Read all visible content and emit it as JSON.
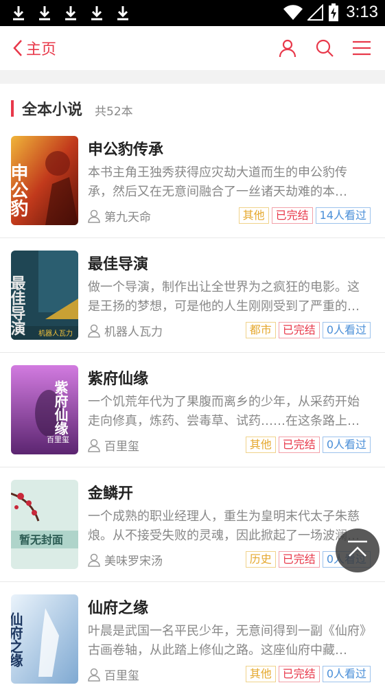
{
  "status_bar": {
    "time": "3:13",
    "download_icons": [
      "download-icon",
      "download-icon",
      "download-icon",
      "download-icon",
      "download-icon"
    ],
    "icons": [
      "wifi-icon",
      "signal-icon",
      "battery-charging-icon"
    ]
  },
  "nav": {
    "back_label": "主页",
    "icons": [
      "user-icon",
      "search-icon",
      "menu-icon"
    ],
    "accent": "#e8384a"
  },
  "section": {
    "title": "全本小说",
    "count": "共52本"
  },
  "books": [
    {
      "title": "申公豹传承",
      "description": "本书主角王独秀获得应灾劫大道而生的申公豹传承，然后又在无意间融合了一丝诸天劫难的本源……",
      "author": "第九天命",
      "category": "其他",
      "status": "已完结",
      "views": "14人看过"
    },
    {
      "title": "最佳导演",
      "description": "做一个导演，制作出让全世界为之疯狂的电影。这是王扬的梦想，可是他的人生刚刚受到了严重的打击……",
      "author": "机器人瓦力",
      "category": "都市",
      "status": "已完结",
      "views": "0人看过"
    },
    {
      "title": "紫府仙缘",
      "description": "一个饥荒年代为了果腹而离乡的少年，从采药开始走向修真，炼药、尝毒草、试药……在这条路上越走越远……",
      "author": "百里玺",
      "category": "其他",
      "status": "已完结",
      "views": "0人看过"
    },
    {
      "title": "金鳞开",
      "description": "一个成熟的职业经理人，重生为皇明末代太子朱慈烺。从不接受失败的灵魂，因此掀起了一场波澜壮阔的……",
      "author": "美味罗宋汤",
      "category": "历史",
      "status": "已完结",
      "views": "0人看过"
    },
    {
      "title": "仙府之缘",
      "description": "叶晨是武国一名平民少年，无意间得到一副《仙府》古画卷轴，从此踏上修仙之路。这座仙府中藏着……",
      "author": "百里玺",
      "category": "其他",
      "status": "已完结",
      "views": "0人看过"
    }
  ],
  "covers": [
    {
      "text": "申公豹",
      "sub": "第九天命",
      "bg": "#c23a1c"
    },
    {
      "text": "最佳导演",
      "sub": "机器人瓦力",
      "bg": "#1f4654"
    },
    {
      "text": "紫府仙缘",
      "sub": "百里玺",
      "bg": "#8a3fa8"
    },
    {
      "text": "暂无封面",
      "sub": "",
      "bg": "#cfe3dc"
    },
    {
      "text": "仙府之缘",
      "sub": "百里玺",
      "bg": "#9fc2e0"
    }
  ],
  "floating_button": {
    "icon": "back-to-top-icon"
  }
}
